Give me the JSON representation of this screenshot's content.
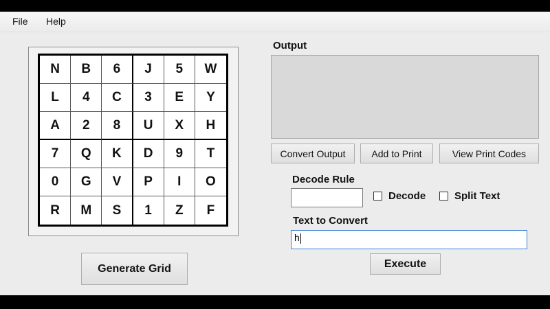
{
  "menu": {
    "file": "File",
    "help": "Help"
  },
  "grid": [
    [
      "N",
      "B",
      "6",
      "J",
      "5",
      "W"
    ],
    [
      "L",
      "4",
      "C",
      "3",
      "E",
      "Y"
    ],
    [
      "A",
      "2",
      "8",
      "U",
      "X",
      "H"
    ],
    [
      "7",
      "Q",
      "K",
      "D",
      "9",
      "T"
    ],
    [
      "0",
      "G",
      "V",
      "P",
      "I",
      "O"
    ],
    [
      "R",
      "M",
      "S",
      "1",
      "Z",
      "F"
    ]
  ],
  "buttons": {
    "generate_grid": "Generate Grid",
    "convert_output": "Convert Output",
    "add_to_print": "Add to Print",
    "view_print_codes": "View Print Codes",
    "execute": "Execute"
  },
  "output": {
    "label": "Output",
    "value": ""
  },
  "decode_rule": {
    "label": "Decode Rule",
    "value": ""
  },
  "checkboxes": {
    "decode": {
      "label": "Decode",
      "checked": false
    },
    "split_text": {
      "label": "Split Text",
      "checked": false
    }
  },
  "text_to_convert": {
    "label": "Text to Convert",
    "value": "h"
  }
}
